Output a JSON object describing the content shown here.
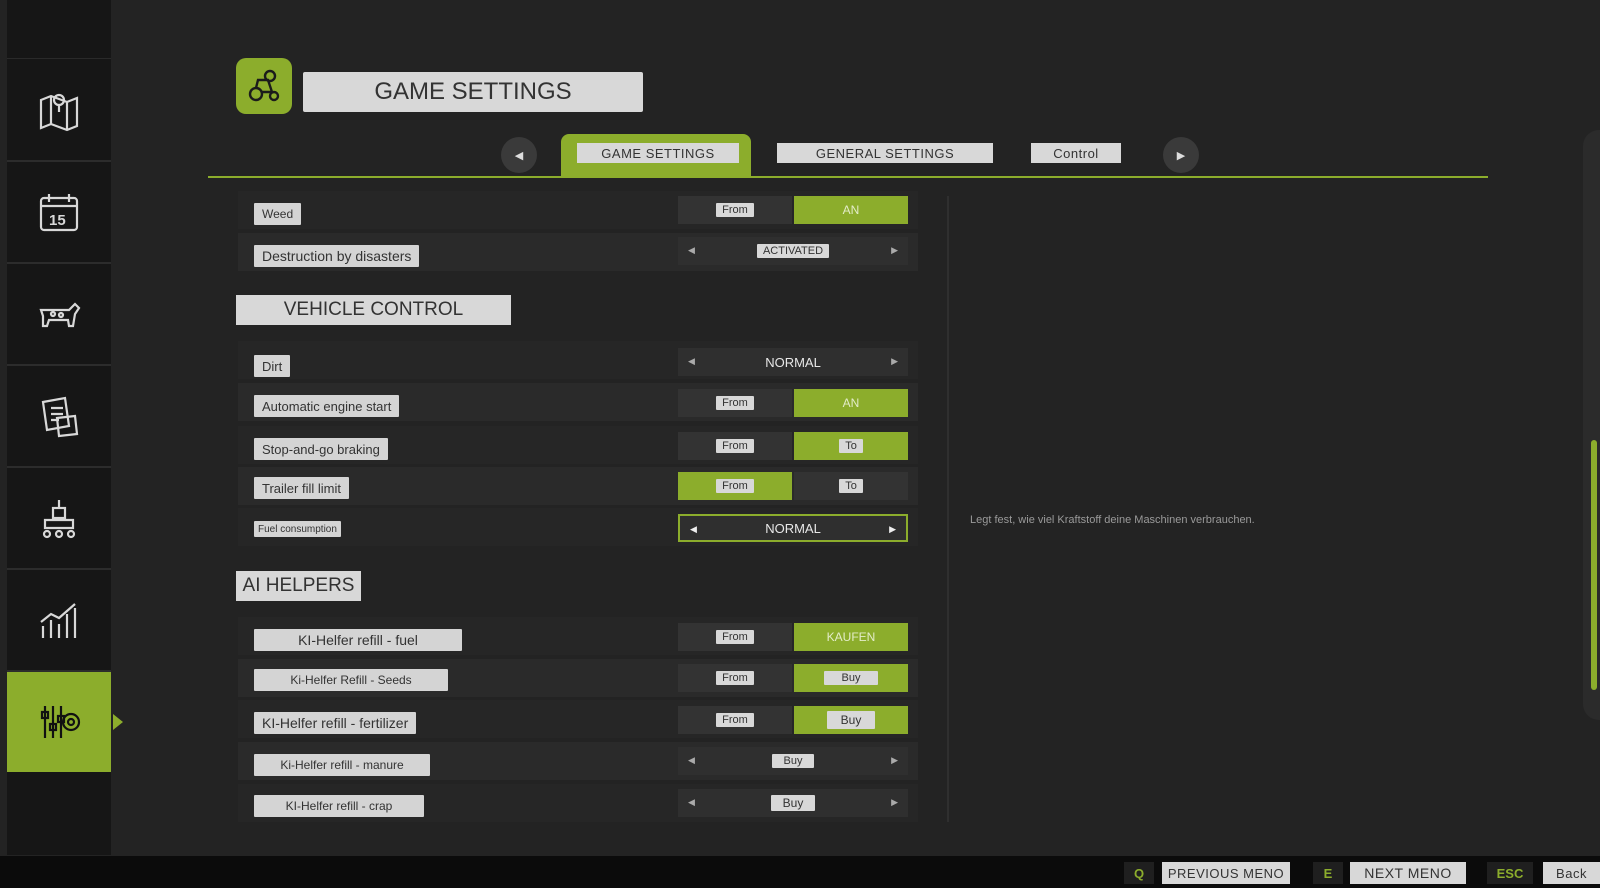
{
  "header": {
    "title": "GAME SETTINGS",
    "icon": "tractor-gear-icon"
  },
  "tabs": [
    {
      "label": "GAME SETTINGS",
      "active": true
    },
    {
      "label": "GENERAL SETTINGS",
      "active": false
    },
    {
      "label": "Control",
      "active": false
    }
  ],
  "sidebar": {
    "items": [
      {
        "icon": "map-icon",
        "active": false
      },
      {
        "icon": "calendar-icon",
        "active": false,
        "text": "15"
      },
      {
        "icon": "cow-icon",
        "active": false
      },
      {
        "icon": "contracts-icon",
        "active": false
      },
      {
        "icon": "production-icon",
        "active": false
      },
      {
        "icon": "statistics-icon",
        "active": false
      },
      {
        "icon": "settings-sliders-icon",
        "active": true
      }
    ]
  },
  "rows_top": {
    "weed": {
      "label": "Weed",
      "off": "From",
      "on": "AN"
    },
    "disasters": {
      "label": "Destruction by disasters",
      "value": "ACTIVATED"
    }
  },
  "vehicle_control": {
    "title": "VEHICLE CONTROL",
    "dirt": {
      "label": "Dirt",
      "value": "NORMAL"
    },
    "engine": {
      "label": "Automatic engine start",
      "off": "From",
      "on": "AN"
    },
    "braking": {
      "label": "Stop-and-go braking",
      "off": "From",
      "on": "To"
    },
    "trailer": {
      "label": "Trailer fill limit",
      "off": "From",
      "on": "To"
    },
    "fuel": {
      "label": "Fuel consumption",
      "value": "NORMAL"
    }
  },
  "ai_helpers": {
    "title": "AI HELPERS",
    "fuel": {
      "label": "KI-Helfer refill - fuel",
      "off": "From",
      "on": "KAUFEN"
    },
    "seeds": {
      "label": "Ki-Helfer Refill - Seeds",
      "off": "From",
      "on": "Buy"
    },
    "fertilizer": {
      "label": "KI-Helfer refill - fertilizer",
      "off": "From",
      "on": "Buy"
    },
    "manure": {
      "label": "Ki-Helfer refill - manure",
      "value": "Buy"
    },
    "crap": {
      "label": "KI-Helfer refill - crap",
      "value": "Buy"
    }
  },
  "description": "Legt fest, wie viel Kraftstoff deine Maschinen verbrauchen.",
  "footer": {
    "prev_key": "Q",
    "prev_label": "PREVIOUS MENO",
    "next_key": "E",
    "next_label": "NEXT MENO",
    "back_key": "ESC",
    "back_label": "Back"
  },
  "colors": {
    "accent": "#8cad2c",
    "background": "#232323",
    "sidebar": "#161616"
  }
}
